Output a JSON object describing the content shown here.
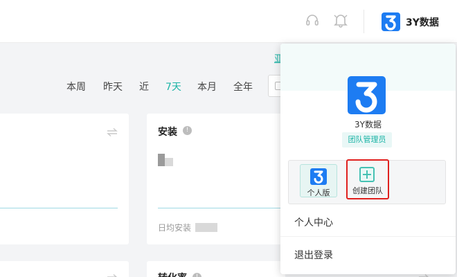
{
  "header": {
    "brand_name": "3Y数据",
    "icons": [
      "headset-icon",
      "bell-icon"
    ]
  },
  "link_partial": "亚",
  "range_tabs": [
    {
      "label": "本周",
      "active": false
    },
    {
      "label": "昨天",
      "active": false
    },
    {
      "label": "近",
      "active": false
    },
    {
      "label": "7天",
      "active": true
    },
    {
      "label": "本月",
      "active": false
    },
    {
      "label": "全年",
      "active": false
    }
  ],
  "cards": {
    "install": {
      "title": "安装",
      "help": "!",
      "daily_label": "日均安装"
    },
    "conversion": {
      "title": "转化率",
      "help": "!"
    }
  },
  "dropdown": {
    "user_name": "3Y数据",
    "role": "团队管理员",
    "personal_version": "个人版",
    "create_team": "创建团队",
    "menu": {
      "profile": "个人中心",
      "logout": "退出登录"
    }
  },
  "colors": {
    "accent": "#19b3a5",
    "brand": "#1d7cf2",
    "highlight": "#e0201e"
  }
}
